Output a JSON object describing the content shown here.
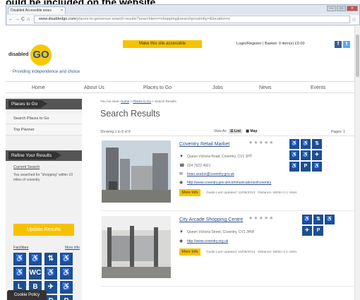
{
  "caption": "ould be included on the website.",
  "browser": {
    "tab_title": "Disabled Accessible searc",
    "tab_close": "×",
    "address_url_domain": "www.disabledgo.com",
    "address_url_path": "/places-to-go/venue-search-results?searchterm=shopping&searchproximity=&location=s",
    "back": "←",
    "forward": "→",
    "reload": "C",
    "home": "⌂",
    "minimize": "—",
    "maximize": "▭",
    "close": "✕"
  },
  "site": {
    "logo_text": "disabled",
    "logo_go": "GO",
    "tagline": "Providing independence and choice",
    "accessible_button": "Make this site accessible",
    "login_basket": "Login/Register | Basket: 0 item(s) £0.00",
    "social_fb": "f",
    "social_tw": "t",
    "nav": [
      "Home",
      "About Us",
      "Places to Go",
      "Jobs",
      "News",
      "Events"
    ]
  },
  "sidebar": {
    "places_heading": "Places to Go",
    "links": [
      "Search Places to Go",
      "Trip Planner"
    ],
    "refine_heading": "Refine Your Results",
    "current_search_label": "Current Search",
    "current_search_text": "You searched for \"shopping\" within 10 miles of coventry",
    "update_button": "Update Results",
    "facilities_label": "Facilities",
    "more_info": "More info",
    "facility_icons": [
      "♿",
      "♿",
      "⇅",
      "♿",
      "♿",
      "WC",
      "♿",
      "♿",
      "L",
      "B",
      "✈",
      "♿",
      "☺",
      "⌂",
      "P",
      "P"
    ]
  },
  "content": {
    "breadcrumb_prefix": "You Are Here:",
    "breadcrumb_home": "Home",
    "breadcrumb_places": "Places to Go",
    "breadcrumb_current": "Search Results",
    "heading": "Search Results",
    "showing": "Showing 1 to 8 of 8",
    "view_as": "View As",
    "view_list": "List",
    "view_map": "Map",
    "pages": "Pages: 1",
    "results": [
      {
        "title": "Coventry Retail Market",
        "stars": "★★★★★",
        "address": "Queen Victoria Road, Coventry, CV1 3HT",
        "phone": "024 7622 4921",
        "email": "brian.seaton@coventry.gov.uk",
        "website": "http://www.coventry.gov.uk/communicationsofcoventry",
        "more_info": "More Info",
        "updated": "Guide Last Updated: 12/09/2013",
        "distance": "Distance: Within 0.1 miles",
        "icons": [
          "♿",
          "♿",
          "⇅",
          "♿",
          "♿",
          "✈",
          "♿",
          "P",
          "♿"
        ]
      },
      {
        "title": "City Arcade Shopping Centre",
        "stars": "★★★★★",
        "address": "Queen Victoria Street, Coventry, CV1 3HW",
        "website": "http://www.coventry.org.uk",
        "more_info": "More Info",
        "updated": "Guide Last Updated: 15/09/2013",
        "distance": "Distance: Within 0.1 miles",
        "icons": [
          "♿",
          "⇅",
          "♿",
          "✈",
          "P"
        ]
      }
    ]
  },
  "cookie_policy": "Cookie Policy"
}
